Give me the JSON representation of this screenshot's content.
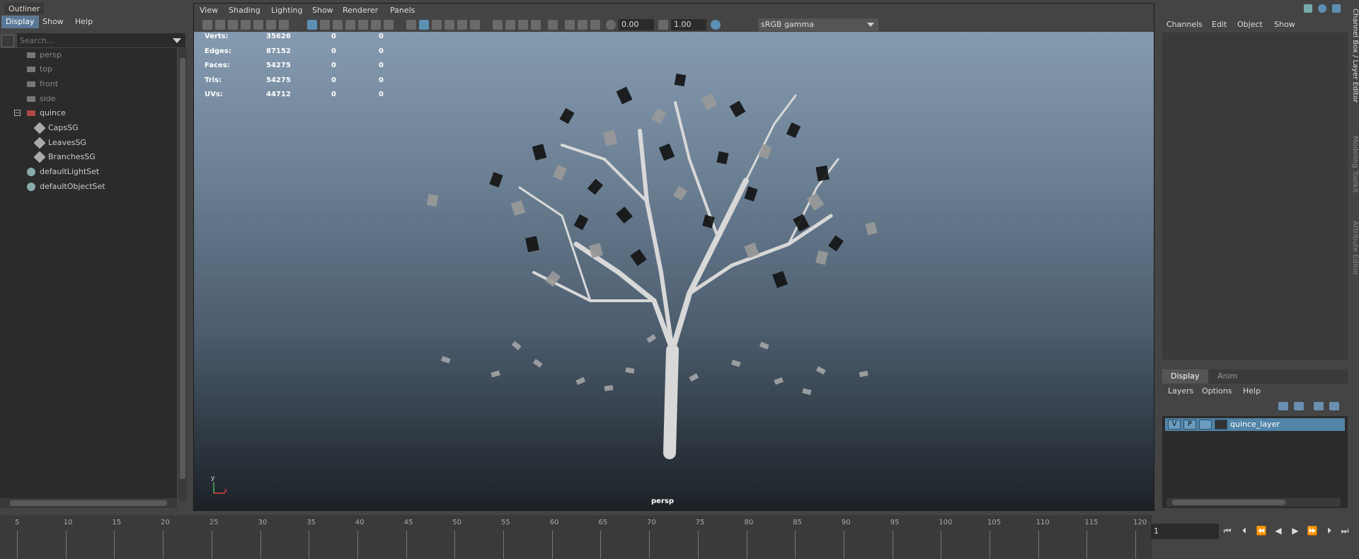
{
  "outliner": {
    "title": "Outliner",
    "menu": [
      "Display",
      "Show",
      "Help"
    ],
    "search_placeholder": "Search...",
    "items": [
      "persp",
      "top",
      "front",
      "side",
      "quince",
      "CapsSG",
      "LeavesSG",
      "BranchesSG",
      "defaultLightSet",
      "defaultObjectSet"
    ]
  },
  "viewport": {
    "menu": [
      "View",
      "Shading",
      "Lighting",
      "Show",
      "Renderer",
      "Panels"
    ],
    "exposure": "0.00",
    "gamma": "1.00",
    "color_space": "sRGB gamma",
    "camera_label": "persp",
    "axis_y": "y",
    "axis_x": "x",
    "hud": [
      {
        "label": "Verts:",
        "v1": "35626",
        "v2": "0",
        "v3": "0"
      },
      {
        "label": "Edges:",
        "v1": "87152",
        "v2": "0",
        "v3": "0"
      },
      {
        "label": "Faces:",
        "v1": "54275",
        "v2": "0",
        "v3": "0"
      },
      {
        "label": "Tris:",
        "v1": "54275",
        "v2": "0",
        "v3": "0"
      },
      {
        "label": "UVs:",
        "v1": "44712",
        "v2": "0",
        "v3": "0"
      }
    ]
  },
  "channel_box": {
    "menu": [
      "Channels",
      "Edit",
      "Object",
      "Show"
    ]
  },
  "layer_editor": {
    "tabs": [
      "Display",
      "Anim"
    ],
    "menu": [
      "Layers",
      "Options",
      "Help"
    ],
    "layer": {
      "v": "V",
      "p": "P",
      "name": "quince_layer"
    }
  },
  "side_tabs": [
    "Channel Box / Layer Editor",
    "Modeling Toolkit",
    "Attribute Editor"
  ],
  "timeline": {
    "ticks": [
      "5",
      "10",
      "15",
      "20",
      "25",
      "30",
      "35",
      "40",
      "45",
      "50",
      "55",
      "60",
      "65",
      "70",
      "75",
      "80",
      "85",
      "90",
      "95",
      "100",
      "105",
      "110",
      "115",
      "120"
    ],
    "current_frame": "1"
  }
}
